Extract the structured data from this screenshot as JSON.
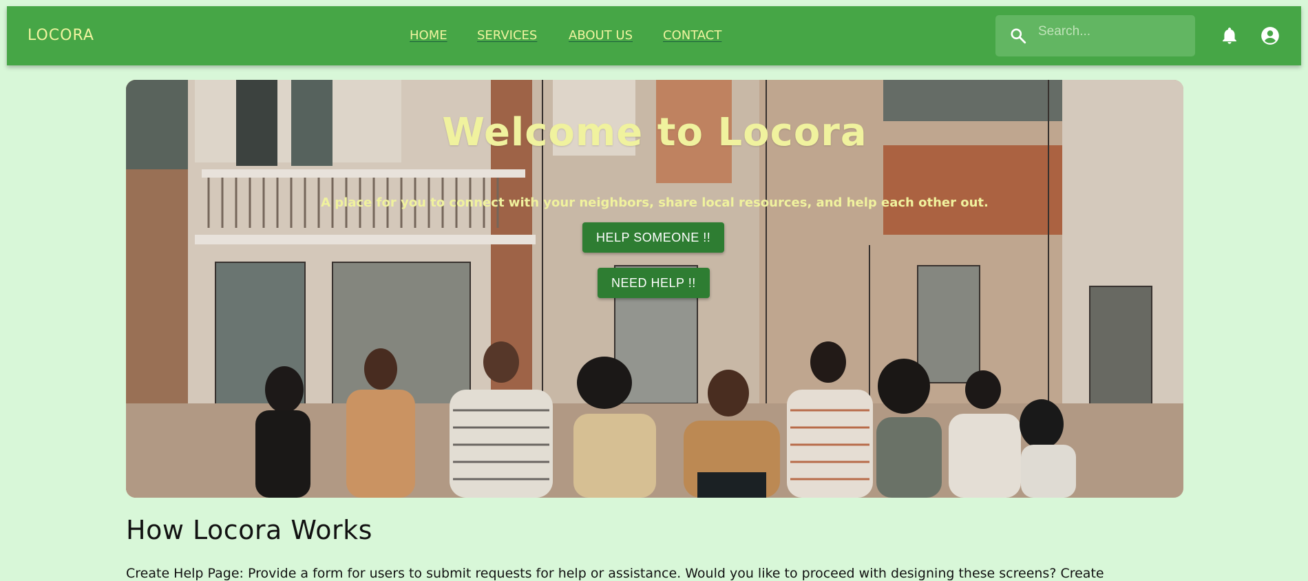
{
  "header": {
    "brand": "LOCORA",
    "nav": [
      "HOME",
      "SERVICES",
      "ABOUT US",
      "CONTACT"
    ],
    "search": {
      "placeholder": "Search...",
      "value": "",
      "icon": "search-icon"
    },
    "icons": [
      "bell-icon",
      "account-circle-icon"
    ]
  },
  "hero": {
    "title": "Welcome to Locora",
    "subtitle": "A place for you to connect with your neighbors, share local resources, and help each other out.",
    "primary_button": "HELP SOMEONE !!",
    "secondary_button": "NEED HELP !!"
  },
  "section": {
    "title": "How Locora Works",
    "body": "Create Help Page: Provide a form for users to submit requests for help or assistance. Would you like to proceed with designing these screens? Create"
  },
  "colors": {
    "page_bg": "#d8f7d8",
    "appbar": "#46a646",
    "accent_text": "#f0f29e",
    "button": "#2e7d32"
  }
}
